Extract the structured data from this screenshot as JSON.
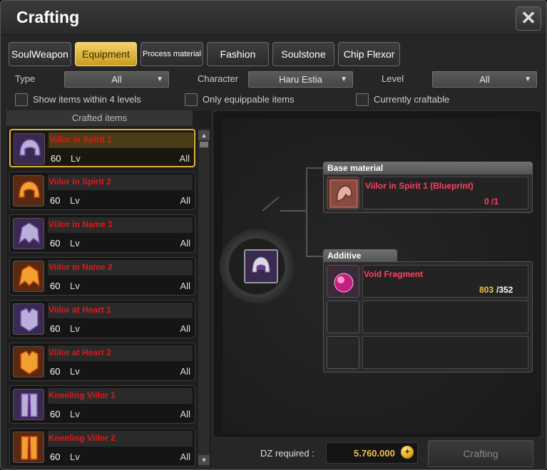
{
  "window": {
    "title": "Crafting"
  },
  "tabs": [
    {
      "label": "SoulWeapon",
      "active": false
    },
    {
      "label": "Equipment",
      "active": true
    },
    {
      "label": "Process material",
      "active": false
    },
    {
      "label": "Fashion",
      "active": false
    },
    {
      "label": "Soulstone",
      "active": false
    },
    {
      "label": "Chip Flexor",
      "active": false
    }
  ],
  "filters": {
    "type_label": "Type",
    "type_value": "All",
    "character_label": "Character",
    "character_value": "Haru Estia",
    "level_label": "Level",
    "level_value": "All"
  },
  "checkboxes": [
    {
      "label": "Show items within 4 levels",
      "checked": false
    },
    {
      "label": "Only equippable items",
      "checked": false
    },
    {
      "label": "Currently craftable",
      "checked": false
    }
  ],
  "list": {
    "header": "Crafted items",
    "lv_suffix": "Lv",
    "items": [
      {
        "name": "Viilor in Spirit 1",
        "level": "60",
        "class": "All",
        "selected": true,
        "icon": "helmet-icon",
        "tint": "purple"
      },
      {
        "name": "Viilor in Spirit 2",
        "level": "60",
        "class": "All",
        "selected": false,
        "icon": "helmet-icon",
        "tint": "orange"
      },
      {
        "name": "Viilor in Name 1",
        "level": "60",
        "class": "All",
        "selected": false,
        "icon": "shoulder-armor-icon",
        "tint": "purple"
      },
      {
        "name": "Viilor in Name 2",
        "level": "60",
        "class": "All",
        "selected": false,
        "icon": "shoulder-armor-icon",
        "tint": "orange"
      },
      {
        "name": "Viilor at Heart 1",
        "level": "60",
        "class": "All",
        "selected": false,
        "icon": "chest-armor-icon",
        "tint": "purple"
      },
      {
        "name": "Viilor at Heart 2",
        "level": "60",
        "class": "All",
        "selected": false,
        "icon": "chest-armor-icon",
        "tint": "orange"
      },
      {
        "name": "Kneeling Viilor 1",
        "level": "60",
        "class": "All",
        "selected": false,
        "icon": "leg-armor-icon",
        "tint": "purple"
      },
      {
        "name": "Kneeling Viilor 2",
        "level": "60",
        "class": "All",
        "selected": false,
        "icon": "leg-armor-icon",
        "tint": "orange"
      }
    ]
  },
  "recipe": {
    "result_icon": "helmet-icon",
    "base_label": "Base material",
    "base_item": {
      "name": "Viilor in Spirit 1 (Blueprint)",
      "owned": "0",
      "required": "/1",
      "icon": "blueprint-icon"
    },
    "additive_label": "Additive",
    "additive_item": {
      "name": "Void Fragment",
      "owned": "803",
      "required": "/352",
      "icon": "void-fragment-icon"
    }
  },
  "footer": {
    "dz_label": "DZ required :",
    "dz_value": "5.760.000",
    "coin_icon": "gold-coin-icon",
    "craft_button": "Crafting"
  },
  "colors": {
    "active_tab": "#e8bf3c",
    "item_name": "#e01818",
    "material_name": "#ff4060",
    "owned_insufficient": "#ff4060",
    "owned_sufficient": "#f2c34a",
    "dz_value": "#f2c34a"
  }
}
